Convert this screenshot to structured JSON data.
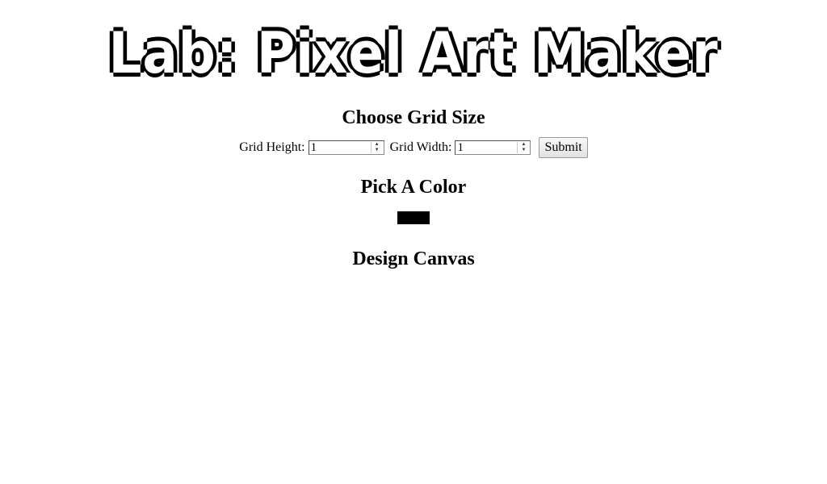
{
  "page": {
    "title": "Lab: Pixel Art Maker"
  },
  "grid_size": {
    "heading": "Choose Grid Size",
    "height_label": "Grid Height:",
    "height_value": "1",
    "width_label": "Grid Width:",
    "width_value": "1",
    "submit_label": "Submit"
  },
  "color": {
    "heading": "Pick A Color",
    "selected_color": "#000000"
  },
  "canvas": {
    "heading": "Design Canvas"
  }
}
